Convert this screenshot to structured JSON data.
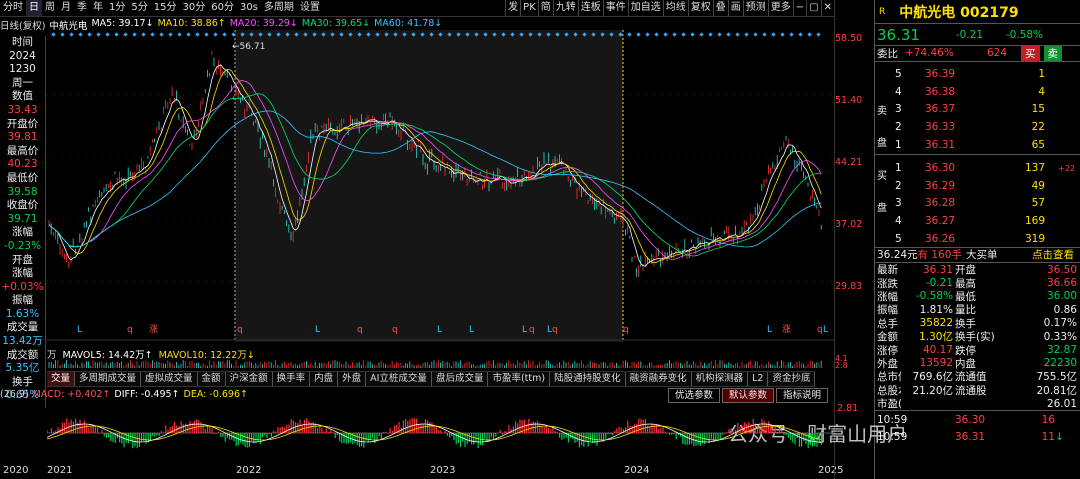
{
  "topbar": {
    "items": [
      "分时",
      "日",
      "周",
      "月",
      "季",
      "年",
      "1分",
      "5分",
      "15分",
      "30分",
      "60分",
      "30s",
      "多周期",
      "设置"
    ],
    "active": "日"
  },
  "toolbar_right": [
    "发",
    "PK",
    "简",
    "九转",
    "连板",
    "事件",
    "加自选",
    "均线",
    "复权",
    "叠",
    "画",
    "预测",
    "更多"
  ],
  "window_controls": [
    "−",
    "▢",
    "✕"
  ],
  "ma_bar": {
    "title": "日线(复权)",
    "name": "中航光电",
    "ma5": "MA5: 39.17↓",
    "ma10": "MA10: 38.86↑",
    "ma20": "MA20: 39.29↓",
    "ma30": "MA30: 39.65↓",
    "ma60": "MA60: 41.78↓"
  },
  "side_panel": [
    {
      "t": "时间",
      "c": "wh"
    },
    {
      "t": "2024",
      "c": "wh"
    },
    {
      "t": "1230",
      "c": "wh"
    },
    {
      "t": "周一",
      "c": "wh"
    },
    {
      "t": "数值",
      "c": "wh"
    },
    {
      "t": "33.43",
      "c": "red"
    },
    {
      "t": "开盘价",
      "c": "wh"
    },
    {
      "t": "39.81",
      "c": "red"
    },
    {
      "t": "最高价",
      "c": "wh"
    },
    {
      "t": "40.23",
      "c": "red"
    },
    {
      "t": "最低价",
      "c": "wh"
    },
    {
      "t": "39.58",
      "c": "grn"
    },
    {
      "t": "收盘价",
      "c": "wh"
    },
    {
      "t": "39.71",
      "c": "grn"
    },
    {
      "t": "涨幅",
      "c": "wh"
    },
    {
      "t": "-0.23%",
      "c": "grn"
    },
    {
      "t": "开盘",
      "c": "wh"
    },
    {
      "t": "涨幅",
      "c": "wh"
    },
    {
      "t": "+0.03%",
      "c": "red"
    },
    {
      "t": "振幅",
      "c": "wh"
    },
    {
      "t": "1.63%",
      "c": "cy"
    },
    {
      "t": "成交量",
      "c": "wh"
    },
    {
      "t": "13.42万",
      "c": "cy"
    },
    {
      "t": "成交额",
      "c": "wh"
    },
    {
      "t": "5.35亿",
      "c": "cy"
    },
    {
      "t": "换手",
      "c": "wh"
    },
    {
      "t": "0.65%",
      "c": "cy"
    }
  ],
  "price_axis": [
    "58.50",
    "51.40",
    "44.21",
    "37.02",
    "29.83"
  ],
  "high_marker": "56.71",
  "vol_bar": {
    "unit": "万",
    "mavol5": "MAVOL5: 14.42万↑",
    "mavol10": "MAVOL10: 12.22万↓"
  },
  "vol_axis": [
    "4.1",
    "2.8"
  ],
  "bottom_tabs": [
    "交量",
    "多周期成交量",
    "虚拟成交量",
    "金额",
    "沪深金额",
    "换手率",
    "内盘",
    "外盘",
    "AI立桩成交量",
    "盘后成交量",
    "市盈率(ttm)",
    "陆股通持股变化",
    "融资融券变化",
    "机构探测器",
    "L2",
    "资金抄底"
  ],
  "macd_bar": {
    "params": "(26,9)",
    "macd": "MACD: +0.402↑",
    "diff": "DIFF: -0.495↑",
    "dea": "DEA: -0.696↑"
  },
  "macd_buttons": [
    "优选参数",
    "默认参数",
    "指标说明"
  ],
  "macd_axis": [
    "2.81"
  ],
  "year_labels": [
    "2020",
    "2021",
    "2022",
    "2023",
    "2024",
    "2025"
  ],
  "chart_markers": [
    "L",
    "q",
    "涨",
    "q",
    "L",
    "q",
    "q",
    "L",
    "L",
    "L",
    "q",
    "L",
    "q",
    "q",
    "L",
    "涨",
    "q",
    "L"
  ],
  "watermark": "公众号 · 财富山用户",
  "quote": {
    "title": "中航光电 002179",
    "r_badge": "R",
    "price": "36.31",
    "change": "-0.21",
    "pct": "-0.58%",
    "webi_label": "委比",
    "webi": "+74.46%",
    "weicha": "624",
    "buy_btn": "买",
    "sell_btn": "卖",
    "sell_label": [
      "卖",
      "盘"
    ],
    "buy_label": [
      "买",
      "盘"
    ],
    "asks": [
      [
        "5",
        "36.39",
        "1"
      ],
      [
        "4",
        "36.38",
        "4"
      ],
      [
        "3",
        "36.37",
        "15"
      ],
      [
        "2",
        "36.33",
        "22"
      ],
      [
        "1",
        "36.31",
        "65"
      ]
    ],
    "bids": [
      [
        "1",
        "36.30",
        "137",
        "+22"
      ],
      [
        "2",
        "36.29",
        "49",
        ""
      ],
      [
        "3",
        "36.28",
        "57",
        ""
      ],
      [
        "4",
        "36.27",
        "169",
        ""
      ],
      [
        "5",
        "36.26",
        "319",
        ""
      ]
    ],
    "big_order": {
      "price": "36.24元",
      "vol": "有 160手",
      "label": "大买单",
      "link": "点击查看"
    },
    "stats": [
      [
        "最新",
        "36.31",
        "red",
        "开盘",
        "36.50",
        "red"
      ],
      [
        "涨跌",
        "-0.21",
        "grn",
        "最高",
        "36.66",
        "red"
      ],
      [
        "涨幅",
        "-0.58%",
        "grn",
        "最低",
        "36.00",
        "grn"
      ],
      [
        "振幅",
        "1.81%",
        "wh",
        "量比",
        "0.86",
        "wh"
      ],
      [
        "总手",
        "35822",
        "yel",
        "换手",
        "0.17%",
        "wh"
      ],
      [
        "金额",
        "1.30亿",
        "yel",
        "换手(实)",
        "0.33%",
        "wh"
      ],
      [
        "涨停",
        "40.17",
        "red",
        "跌停",
        "32.87",
        "grn"
      ],
      [
        "外盘",
        "13592",
        "red",
        "内盘",
        "22230",
        "grn"
      ],
      [
        "总市值",
        "769.6亿",
        "wh",
        "流通值",
        "755.5亿",
        "wh"
      ],
      [
        "总股本",
        "21.20亿",
        "wh",
        "流通股",
        "20.81亿",
        "wh"
      ],
      [
        "市盈(TTM)",
        "",
        "wh",
        "",
        "26.01",
        "wh"
      ]
    ],
    "ticks": [
      [
        "10:59",
        "",
        "36.30",
        "",
        "16",
        ""
      ],
      [
        "10:59",
        "",
        "36.31",
        "",
        "11",
        "↓"
      ]
    ]
  }
}
